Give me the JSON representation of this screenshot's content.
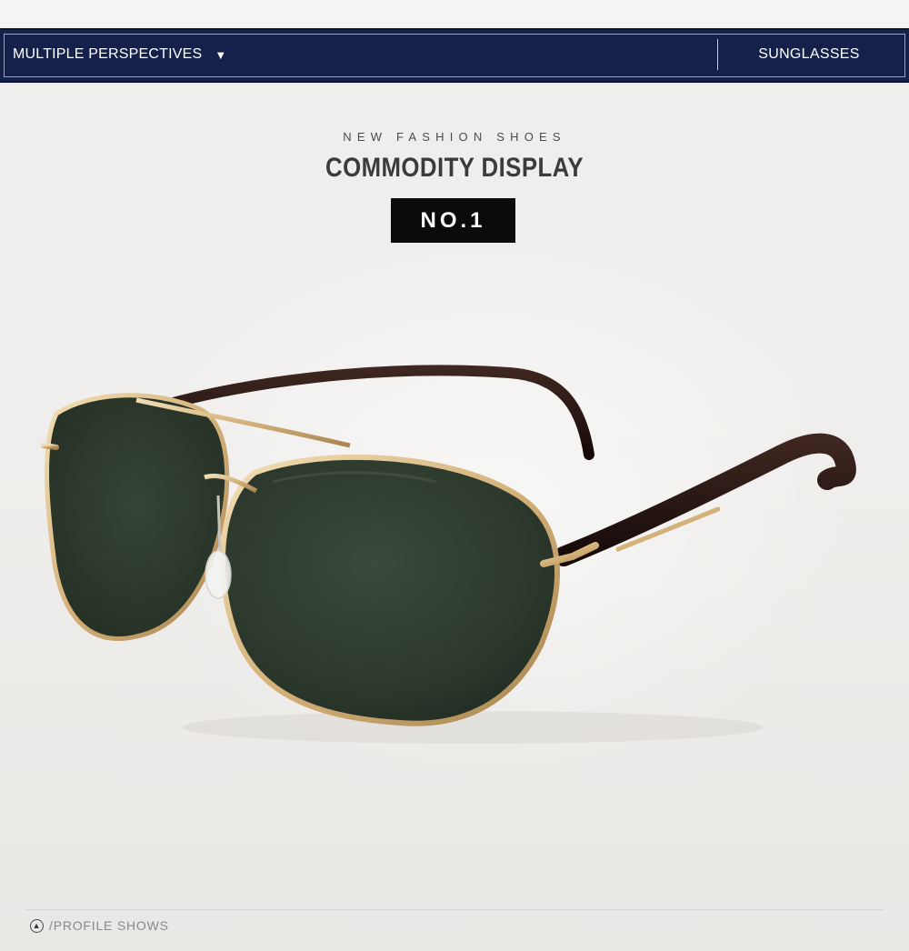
{
  "header": {
    "perspectives_label": "MULTIPLE PERSPECTIVES",
    "perspectives_caret": "▼",
    "category_label": "SUNGLASSES"
  },
  "hero": {
    "subtitle": "NEW FASHION SHOES",
    "title": "COMMODITY DISPLAY",
    "badge": "NO.1"
  },
  "product": {
    "icon": "sunglasses-image",
    "frame_color": "#d4b27a",
    "lens_color": "#2c3a2c",
    "temple_color": "#2a1814"
  },
  "footer": {
    "icon": "up-arrow-icon",
    "label": "/PROFILE SHOWS"
  },
  "colors": {
    "header_bg": "#15214a",
    "background": "#efeeec",
    "badge_bg": "#0b0b0b"
  }
}
